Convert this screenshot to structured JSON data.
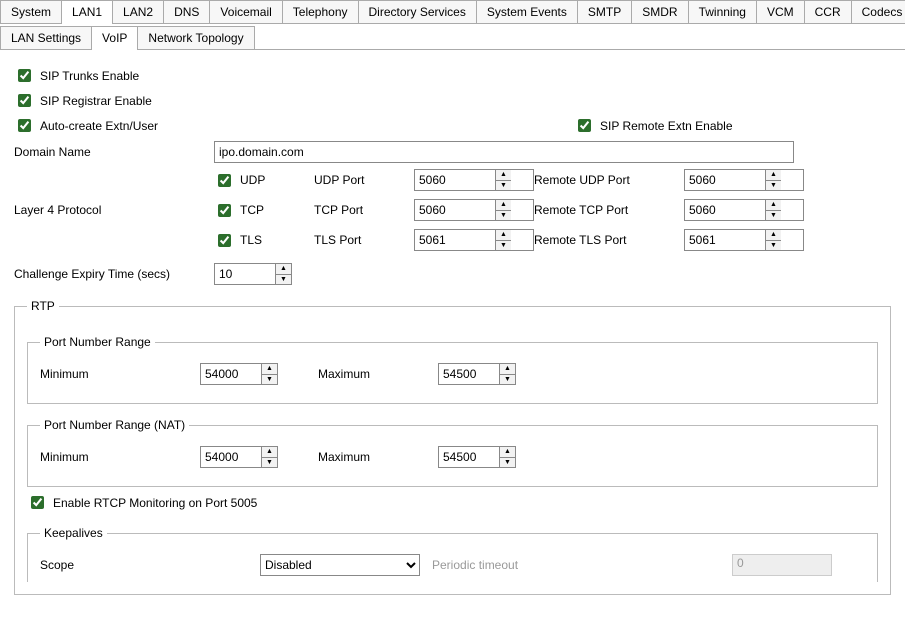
{
  "topTabs": [
    "System",
    "LAN1",
    "LAN2",
    "DNS",
    "Voicemail",
    "Telephony",
    "Directory Services",
    "System Events",
    "SMTP",
    "SMDR",
    "Twinning",
    "VCM",
    "CCR",
    "Codecs"
  ],
  "topActive": "LAN1",
  "subTabs": [
    "LAN Settings",
    "VoIP",
    "Network Topology"
  ],
  "subActive": "VoIP",
  "chk": {
    "sipTrunks": "SIP Trunks Enable",
    "sipRegistrar": "SIP Registrar Enable",
    "autoCreate": "Auto-create Extn/User",
    "sipRemote": "SIP Remote Extn Enable",
    "udp": "UDP",
    "tcp": "TCP",
    "tls": "TLS",
    "rtcp": "Enable RTCP Monitoring on Port 5005"
  },
  "labels": {
    "domain": "Domain Name",
    "layer4": "Layer 4 Protocol",
    "udpPort": "UDP Port",
    "tcpPort": "TCP Port",
    "tlsPort": "TLS Port",
    "remUdp": "Remote UDP Port",
    "remTcp": "Remote TCP Port",
    "remTls": "Remote TLS Port",
    "challenge": "Challenge Expiry Time (secs)",
    "rtp": "RTP",
    "pnr": "Port Number Range",
    "pnrNat": "Port Number Range (NAT)",
    "min": "Minimum",
    "max": "Maximum",
    "keepalives": "Keepalives",
    "scope": "Scope",
    "periodic": "Periodic timeout"
  },
  "values": {
    "domain": "ipo.domain.com",
    "udpPort": "5060",
    "tcpPort": "5060",
    "tlsPort": "5061",
    "remUdp": "5060",
    "remTcp": "5060",
    "remTls": "5061",
    "challenge": "10",
    "pnrMin": "54000",
    "pnrMax": "54500",
    "pnrNatMin": "54000",
    "pnrNatMax": "54500",
    "scope": "Disabled",
    "periodic": "0"
  }
}
